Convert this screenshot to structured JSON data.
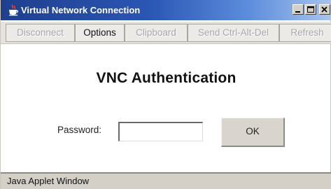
{
  "window": {
    "title": "Virtual Network Connection",
    "icon": "java-cup-icon",
    "controls": [
      "minimize-icon",
      "maximize-icon",
      "close-icon"
    ]
  },
  "toolbar": {
    "disconnect_label": "Disconnect",
    "options_label": "Options",
    "clipboard_label": "Clipboard",
    "send_cad_label": "Send Ctrl-Alt-Del",
    "refresh_label": "Refresh"
  },
  "auth": {
    "heading": "VNC Authentication",
    "password_label": "Password:",
    "password_value": "",
    "ok_label": "OK"
  },
  "status": {
    "text": "Java Applet Window"
  },
  "colors": {
    "titlebar_start": "#1f3f8e",
    "titlebar_end": "#a8c4ee",
    "button_face": "#d9d5ce",
    "disabled_text": "#a7a7a7"
  }
}
